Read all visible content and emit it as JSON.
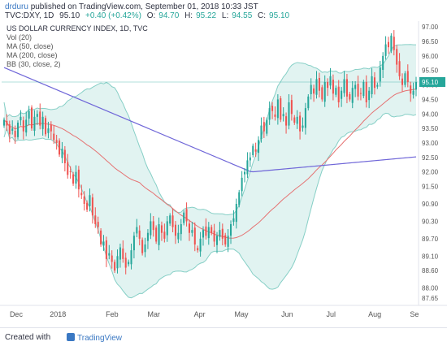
{
  "header": {
    "user": "drduru",
    "published_text": "published on TradingView.com, September 01, 2018 10:33 JST",
    "symbol": "TVC:DXY, 1D",
    "close_label": "95.10",
    "change_label": "+0.40 (+0.42%)",
    "ohlc": [
      {
        "k": "O:",
        "v": "94.70"
      },
      {
        "k": "H:",
        "v": "95.22"
      },
      {
        "k": "L:",
        "v": "94.55"
      },
      {
        "k": "C:",
        "v": "95.10"
      }
    ]
  },
  "legend": {
    "title": "US DOLLAR CURRENCY INDEX, 1D, TVC",
    "items": [
      "Vol (20)",
      "MA (50, close)",
      "MA (200, close)",
      "BB (30, close, 2)"
    ]
  },
  "footer": {
    "created_with": "Created with",
    "brand": "TradingView"
  },
  "colors": {
    "up": "#26a69a",
    "down": "#ef5350",
    "ma50": "#e57373",
    "ma200": "#6f66d8",
    "bb_fill": "#d9f0ee",
    "bb_line": "#86cfc6",
    "price_line": "#26a69a"
  },
  "chart_data": {
    "type": "candlestick",
    "title": "US DOLLAR CURRENCY INDEX, 1D, TVC",
    "ylim": [
      87.4,
      97.2
    ],
    "y_ticks": [
      "97.00",
      "96.50",
      "96.00",
      "95.50",
      "95.00",
      "94.50",
      "94.00",
      "93.50",
      "93.00",
      "92.50",
      "92.00",
      "91.50",
      "90.90",
      "90.30",
      "89.70",
      "89.10",
      "88.60",
      "88.00",
      "87.65"
    ],
    "x_ticks": [
      "Dec",
      "2018",
      "Feb",
      "Mar",
      "Apr",
      "May",
      "Jun",
      "Jul",
      "Aug",
      "Se"
    ],
    "last_price_label": "95.10",
    "last_price": 95.1,
    "close": [
      93.8,
      93.6,
      93.3,
      93.5,
      93.2,
      93.7,
      93.9,
      93.4,
      93.8,
      94.1,
      93.5,
      93.9,
      94.0,
      93.6,
      93.9,
      93.3,
      93.5,
      93.4,
      93.1,
      93.0,
      92.6,
      92.8,
      92.3,
      91.9,
      92.0,
      91.6,
      92.0,
      91.4,
      91.2,
      90.9,
      90.7,
      91.2,
      90.5,
      90.2,
      90.1,
      89.5,
      89.6,
      89.0,
      89.2,
      88.9,
      88.6,
      89.1,
      89.4,
      89.0,
      88.7,
      88.9,
      89.3,
      89.8,
      90.1,
      89.7,
      89.2,
      89.5,
      89.9,
      90.3,
      90.0,
      89.6,
      90.2,
      89.9,
      89.7,
      90.3,
      90.5,
      90.1,
      89.8,
      89.9,
      90.2,
      90.6,
      90.3,
      89.9,
      90.0,
      89.5,
      89.3,
      89.7,
      90.0,
      89.8,
      90.1,
      89.9,
      89.6,
      89.8,
      90.0,
      89.7,
      89.5,
      89.8,
      90.2,
      90.4,
      90.9,
      91.3,
      91.8,
      92.0,
      92.4,
      92.5,
      92.9,
      92.7,
      93.1,
      93.6,
      93.4,
      93.8,
      94.2,
      94.1,
      93.9,
      94.5,
      93.8,
      94.0,
      93.6,
      94.4,
      94.0,
      93.7,
      93.9,
      93.4,
      93.6,
      94.2,
      94.6,
      95.0,
      94.7,
      95.2,
      94.8,
      94.5,
      95.1,
      94.9,
      95.3,
      94.7,
      94.9,
      94.4,
      94.8,
      95.2,
      94.6,
      94.5,
      94.9,
      95.0,
      94.6,
      94.7,
      95.1,
      94.4,
      94.8,
      95.3,
      94.9,
      95.0,
      95.6,
      96.0,
      96.4,
      96.3,
      96.7,
      96.2,
      95.7,
      95.3,
      95.0,
      95.4,
      95.1,
      94.7,
      94.8,
      95.1
    ]
  }
}
